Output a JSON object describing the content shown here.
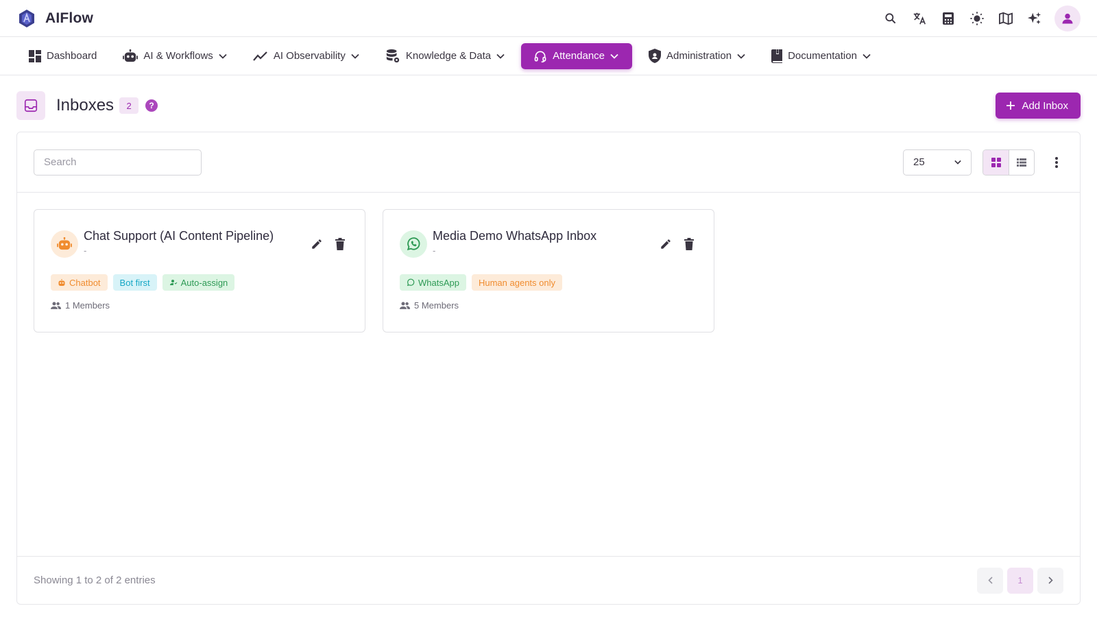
{
  "app": {
    "brand": "AIFlow"
  },
  "topbar": {
    "icons": [
      "search-icon",
      "translate-icon",
      "calculator-icon",
      "sun-icon",
      "book-map-icon",
      "sparkles-icon",
      "user-avatar-icon"
    ]
  },
  "nav": {
    "items": [
      {
        "label": "Dashboard",
        "icon": "dashboard-icon",
        "dropdown": false
      },
      {
        "label": "AI & Workflows",
        "icon": "robot-icon",
        "dropdown": true
      },
      {
        "label": "AI Observability",
        "icon": "trend-line-icon",
        "dropdown": true
      },
      {
        "label": "Knowledge & Data",
        "icon": "database-gear-icon",
        "dropdown": true
      },
      {
        "label": "Attendance",
        "icon": "headset-icon",
        "dropdown": true,
        "active": true
      },
      {
        "label": "Administration",
        "icon": "shield-icon",
        "dropdown": true
      },
      {
        "label": "Documentation",
        "icon": "book-icon",
        "dropdown": true
      }
    ]
  },
  "page": {
    "title": "Inboxes",
    "count": "2",
    "help": "?",
    "add_label": "Add Inbox"
  },
  "toolbar": {
    "search_placeholder": "Search",
    "search_value": "",
    "per_page": "25"
  },
  "cards": [
    {
      "title": "Chat Support (AI Content Pipeline)",
      "subtitle": "-",
      "channel_icon": "robot-icon",
      "tags": [
        {
          "label": "Chatbot",
          "icon": "robot-icon",
          "color": "#f08c2f"
        },
        {
          "label": "Bot first",
          "icon": "",
          "color": "#16a7c5"
        },
        {
          "label": "Auto-assign",
          "icon": "person-assign-icon",
          "color": "#2e9a55"
        }
      ],
      "members": "1 Members"
    },
    {
      "title": "Media Demo WhatsApp Inbox",
      "subtitle": "-",
      "channel_icon": "whatsapp-icon",
      "tags": [
        {
          "label": "WhatsApp",
          "icon": "whatsapp-icon",
          "color": "#2e9a55"
        },
        {
          "label": "Human agents only",
          "icon": "",
          "color": "#f08c2f"
        }
      ],
      "members": "5 Members"
    }
  ],
  "footer": {
    "entries": "Showing 1 to 2 of 2 entries",
    "current_page": "1",
    "prev": "‹",
    "next": "›"
  },
  "colors": {
    "accent": "#9c27b0",
    "accent_light": "#f3e5f5",
    "orange": "#f08c2f",
    "cyan": "#16a7c5",
    "green": "#2e9a55"
  }
}
